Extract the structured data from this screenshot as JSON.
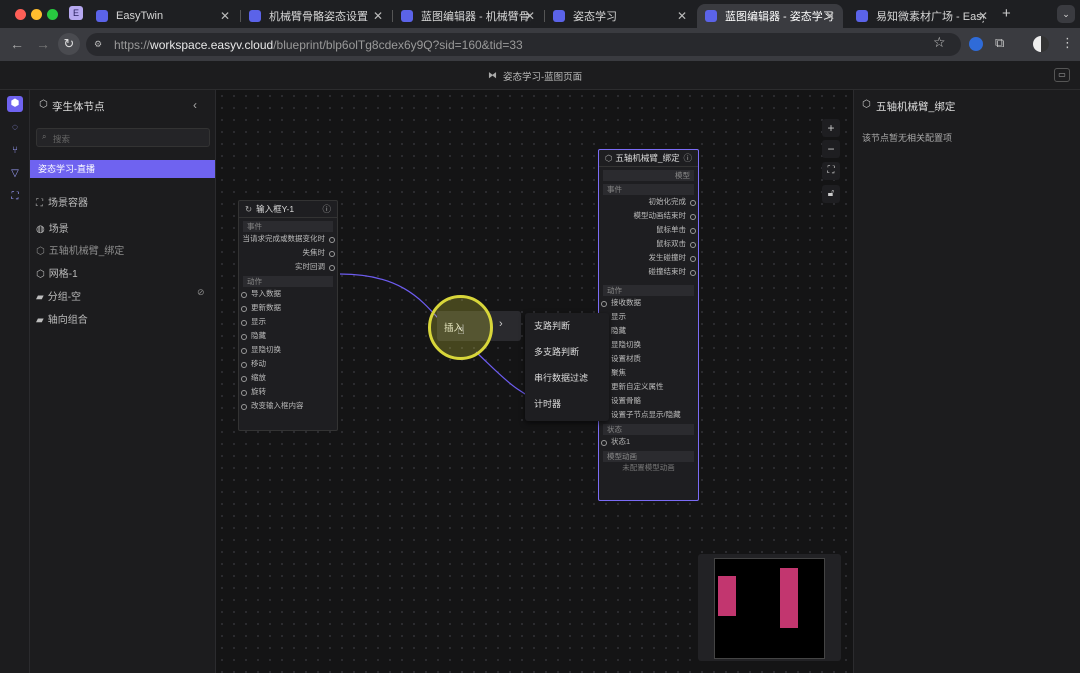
{
  "browser": {
    "tabs": [
      {
        "label": "EasyTwin",
        "active": false
      },
      {
        "label": "机械臂骨骼姿态设置",
        "active": false
      },
      {
        "label": "蓝图编辑器 - 机械臂骨骼姿",
        "active": false
      },
      {
        "label": "姿态学习",
        "active": false
      },
      {
        "label": "蓝图编辑器 - 姿态学习",
        "active": true
      },
      {
        "label": "易知微素材广场 - EasyV数",
        "active": false
      }
    ],
    "profile_letter": "E",
    "url_prefix": "https://",
    "url_host": "workspace.easyv.cloud",
    "url_path": "/blueprint/blp6olTg8cdex6y9Q?sid=160&tid=33"
  },
  "app": {
    "breadcrumb": "姿态学习-蓝图页面"
  },
  "left_panel": {
    "title": "孪生体节点",
    "search_placeholder": "搜索",
    "selected_item": "姿态学习-直播",
    "scene_container": "场景容器",
    "tree": [
      {
        "label": "场景",
        "icon": "globe-icon"
      },
      {
        "label": "五轴机械臂_绑定",
        "icon": "cube-icon"
      },
      {
        "label": "网格-1",
        "icon": "cube-icon"
      },
      {
        "label": "分组-空",
        "icon": "folder-icon"
      },
      {
        "label": "轴向组合",
        "icon": "folder-icon"
      }
    ]
  },
  "node_input": {
    "title": "输入框Y-1",
    "section_events": "事件",
    "events": [
      "当请求完成或数据变化时",
      "失焦时",
      "实时回调"
    ],
    "section_actions": "动作",
    "actions": [
      "导入数据",
      "更新数据",
      "显示",
      "隐藏",
      "显隐切换",
      "移动",
      "缩放",
      "旋转",
      "改变输入框内容"
    ]
  },
  "node_arm": {
    "title": "五轴机械臂_绑定",
    "section_model": "模型",
    "section_events": "事件",
    "events": [
      "初始化完成",
      "模型动画结束时",
      "鼠标单击",
      "鼠标双击",
      "发生碰撞时",
      "碰撞结束时"
    ],
    "section_actions": "动作",
    "actions": [
      "接收数据",
      "显示",
      "隐藏",
      "显隐切换",
      "设置材质",
      "聚焦",
      "更新自定义属性",
      "设置骨骼",
      "设置子节点显示/隐藏"
    ],
    "section_state": "状态",
    "states": [
      "状态1"
    ],
    "section_anim": "模型动画",
    "anim_note": "未配置模型动画"
  },
  "context_menu": {
    "insert_label": "插入",
    "items": [
      "支路判断",
      "多支路判断",
      "串行数据过滤",
      "计时器"
    ]
  },
  "right_panel": {
    "title": "五轴机械臂_绑定",
    "note": "该节点暂无相关配置项"
  },
  "colors": {
    "accent": "#7b6cf6",
    "selected_bg": "#6f63f0",
    "wire": "#6d5cf0",
    "highlight_ring": "#d8d63a",
    "minimap_block": "#c2366f"
  }
}
